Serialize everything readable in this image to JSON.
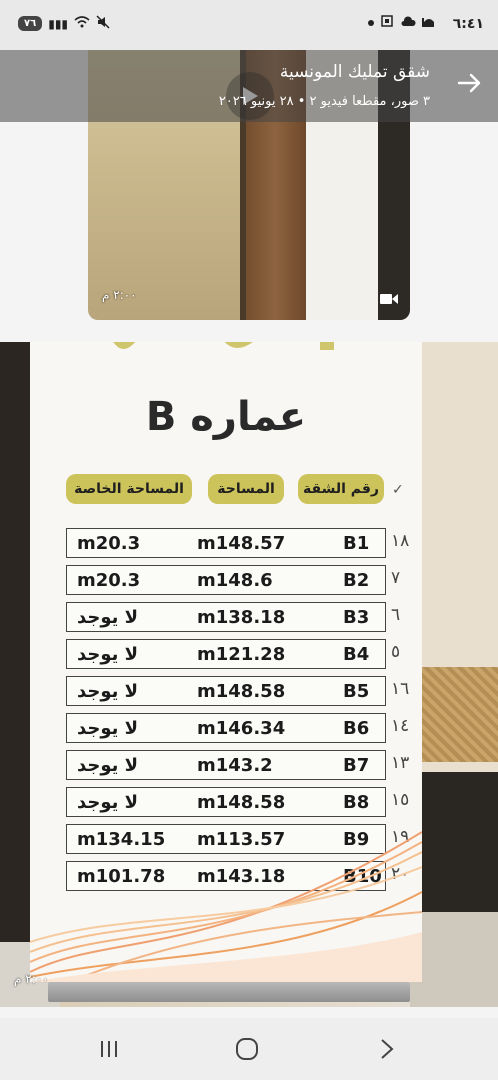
{
  "status_bar": {
    "time": "٦:٤١",
    "battery": "٧٦"
  },
  "header": {
    "title": "شقق تمليك المونسية",
    "subtitle": "٣ صور، مقطعا فيديو ٢ • ٢٨ يونيو ٢٠٢٦"
  },
  "media": [
    {
      "duration": "٢:٠٠ م",
      "type": "video"
    },
    {
      "duration": "٢:٠٠ م",
      "type": "image"
    }
  ],
  "banner": {
    "title": "عماره B",
    "columns": [
      "رقم الشقة",
      "المساحة",
      "المساحة الخاصة"
    ],
    "rows": [
      {
        "unit": "B1",
        "area": "m148.57",
        "private": "m20.3",
        "note": "١٨"
      },
      {
        "unit": "B2",
        "area": "m148.6",
        "private": "m20.3",
        "note": "٧"
      },
      {
        "unit": "B3",
        "area": "m138.18",
        "private": "لا يوجد",
        "note": "٦"
      },
      {
        "unit": "B4",
        "area": "m121.28",
        "private": "لا يوجد",
        "note": "٥"
      },
      {
        "unit": "B5",
        "area": "m148.58",
        "private": "لا يوجد",
        "note": "١٦"
      },
      {
        "unit": "B6",
        "area": "m146.34",
        "private": "لا يوجد",
        "note": "١٤"
      },
      {
        "unit": "B7",
        "area": "m143.2",
        "private": "لا يوجد",
        "note": "١٣"
      },
      {
        "unit": "B8",
        "area": "m148.58",
        "private": "لا يوجد",
        "note": "١٥"
      },
      {
        "unit": "B9",
        "area": "m113.57",
        "private": "m134.15",
        "note": "١٩"
      },
      {
        "unit": "B10",
        "area": "m143.18",
        "private": "m101.78",
        "note": "٢٠"
      }
    ]
  },
  "icons": {
    "back": "arrow-right-icon",
    "play": "play-icon",
    "video": "video-camera-icon",
    "nav_recents": "recents-icon",
    "nav_home": "home-icon",
    "nav_back": "chevron-right-icon"
  },
  "colors": {
    "pill": "#ccc35a",
    "status_bar": "#e9e9e9"
  }
}
